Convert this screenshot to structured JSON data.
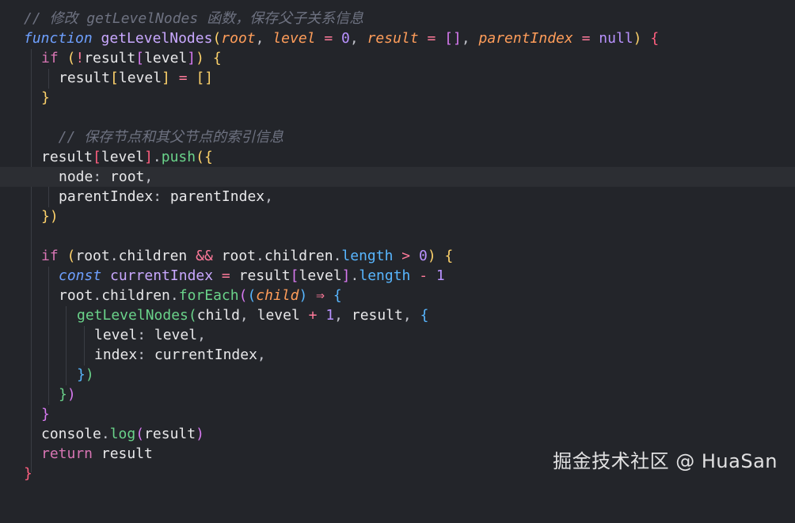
{
  "editor": {
    "lines": [
      "// 修改 getLevelNodes 函数，保存父子关系信息",
      "function getLevelNodes(root, level = 0, result = [], parentIndex = null) {",
      "  if (!result[level]) {",
      "    result[level] = []",
      "  }",
      "",
      "  // 保存节点和其父节点的索引信息",
      "  result[level].push({",
      "    node: root,",
      "    parentIndex: parentIndex,",
      "  })",
      "",
      "  if (root.children && root.children.length > 0) {",
      "    const currentIndex = result[level].length - 1",
      "    root.children.forEach((child) => {",
      "      getLevelNodes(child, level + 1, result, {",
      "        level: level,",
      "        index: currentIndex,",
      "      })",
      "    })",
      "  }",
      "  console.log(result)",
      "  return result",
      "}"
    ]
  },
  "watermark": "掘金技术社区 @ HuaSan"
}
